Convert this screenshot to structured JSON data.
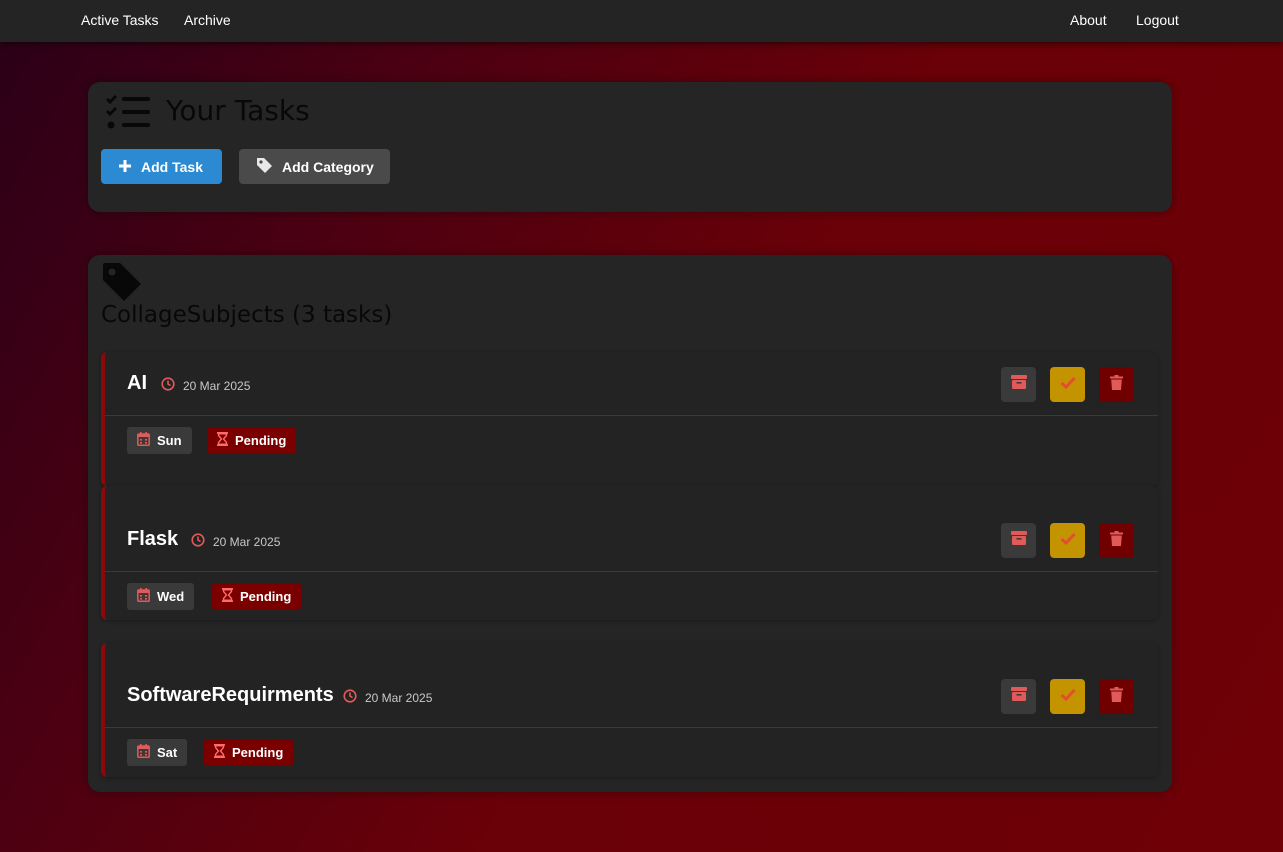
{
  "nav": {
    "active_tasks": "Active Tasks",
    "archive": "Archive",
    "about": "About",
    "logout": "Logout"
  },
  "header": {
    "title": "Your Tasks",
    "add_task": "Add Task",
    "add_category": "Add Category"
  },
  "category": {
    "title": "CollageSubjects (3 tasks)",
    "tasks": [
      {
        "name": "AI",
        "date": "20 Mar 2025",
        "day": "Sun",
        "status": "Pending"
      },
      {
        "name": "Flask",
        "date": "20 Mar 2025",
        "day": "Wed",
        "status": "Pending"
      },
      {
        "name": "SoftwareRequirments",
        "date": "20 Mar 2025",
        "day": "Sat",
        "status": "Pending"
      }
    ]
  },
  "colors": {
    "primary": "#2b8ad2",
    "accent_red": "#e05a5a",
    "done": "#c49300",
    "danger": "#700000"
  },
  "icons": [
    "tasks-list-icon",
    "plus-icon",
    "tag-icon",
    "clock-icon",
    "archive-icon",
    "check-icon",
    "trash-icon",
    "calendar-icon",
    "hourglass-icon"
  ]
}
